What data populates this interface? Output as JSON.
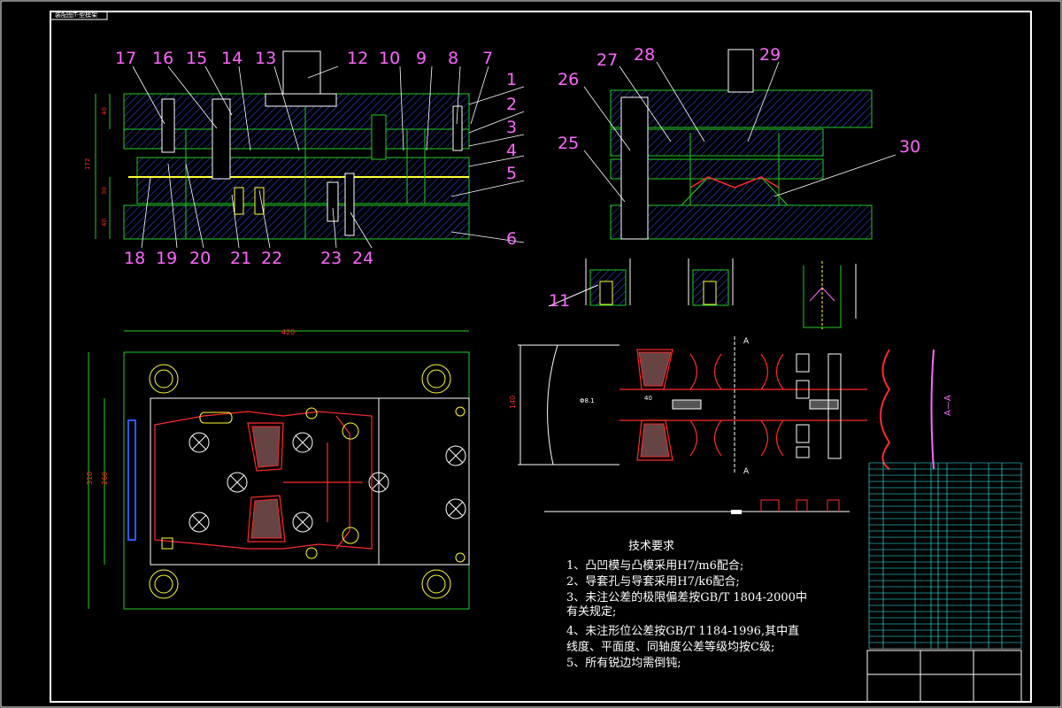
{
  "drawing": {
    "corner_label": "装配图T-型模架",
    "callouts_top_left": [
      "17",
      "16",
      "15",
      "14",
      "13",
      "12",
      "10",
      "9",
      "8",
      "7"
    ],
    "callouts_right_col": [
      "1",
      "2",
      "3",
      "4",
      "5",
      "6"
    ],
    "callouts_bottom_left": [
      "18",
      "19",
      "20",
      "21",
      "22",
      "23",
      "24"
    ],
    "callouts_top_right": [
      "26",
      "27",
      "28",
      "29",
      "30",
      "25"
    ],
    "callout_detail": "11",
    "dims_left": [
      "40",
      "172",
      "30",
      "40"
    ],
    "dim_plan_width": "420",
    "dims_plan_height": [
      "310",
      "260"
    ],
    "dims_strip": [
      "140",
      "40",
      "Φ8.1"
    ],
    "section_mark": "A",
    "section_label": "A—A",
    "tech_notes": {
      "title": "技术要求",
      "lines": [
        "1、凸凹模与凸模采用H7/m6配合;",
        "2、导套孔与导套采用H7/k6配合;",
        "3、未注公差的极限偏差按GB/T 1804-2000中",
        "    有关规定;",
        "4、未注形位公差按GB/T 1184-1996,其中直",
        "    线度、平面度、同轴度公差等级均按C级;",
        "5、所有锐边均需倒钝;"
      ]
    }
  },
  "colors": {
    "green": "#22cc22",
    "white": "#ffffff",
    "magenta": "#ff66ff",
    "red": "#ff2a2a",
    "yellow": "#ffff33",
    "cyan": "#33ffff",
    "blue": "#3355ff"
  }
}
